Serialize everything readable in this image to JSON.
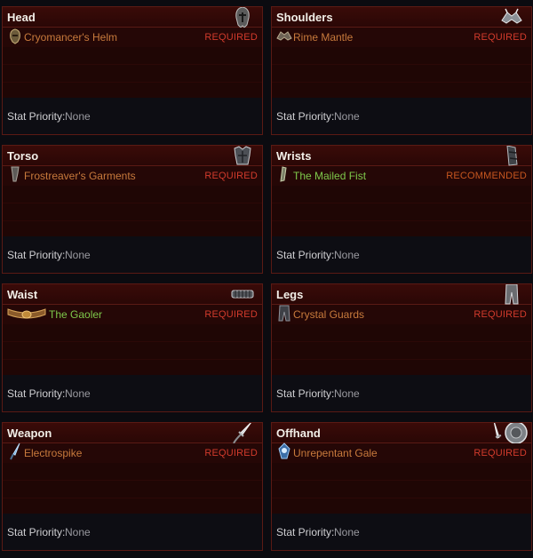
{
  "slots": [
    {
      "title": "Head",
      "icon": "helm-icon",
      "item": "Cryomancer's Helm",
      "item_icon": "helm-item-icon",
      "rarity": "legendary",
      "requirement": "REQUIRED",
      "stat_label": "Stat Priority:",
      "stat_value": "None"
    },
    {
      "title": "Shoulders",
      "icon": "shoulders-icon",
      "item": "Rime Mantle",
      "item_icon": "shoulders-item-icon",
      "rarity": "legendary",
      "requirement": "REQUIRED",
      "stat_label": "Stat Priority:",
      "stat_value": "None"
    },
    {
      "title": "Torso",
      "icon": "chest-armor-icon",
      "item": "Frostreaver's Garments",
      "item_icon": "chest-item-icon",
      "rarity": "legendary",
      "requirement": "REQUIRED",
      "stat_label": "Stat Priority:",
      "stat_value": "None"
    },
    {
      "title": "Wrists",
      "icon": "bracers-icon",
      "item": "The Mailed Fist",
      "item_icon": "bracers-item-icon",
      "rarity": "set",
      "requirement": "RECOMMENDED",
      "stat_label": "Stat Priority:",
      "stat_value": "None"
    },
    {
      "title": "Waist",
      "icon": "belt-icon",
      "item": "The Gaoler",
      "item_icon": "belt-item-icon",
      "rarity": "set",
      "requirement": "REQUIRED",
      "stat_label": "Stat Priority:",
      "stat_value": "None"
    },
    {
      "title": "Legs",
      "icon": "legs-armor-icon",
      "item": "Crystal Guards",
      "item_icon": "legs-item-icon",
      "rarity": "legendary",
      "requirement": "REQUIRED",
      "stat_label": "Stat Priority:",
      "stat_value": "None"
    },
    {
      "title": "Weapon",
      "icon": "dagger-icon",
      "item": "Electrospike",
      "item_icon": "weapon-item-icon",
      "rarity": "legendary",
      "requirement": "REQUIRED",
      "stat_label": "Stat Priority:",
      "stat_value": "None"
    },
    {
      "title": "Offhand",
      "icon": "shield-dagger-icon",
      "item": "Unrepentant Gale",
      "item_icon": "offhand-item-icon",
      "rarity": "legendary",
      "requirement": "REQUIRED",
      "stat_label": "Stat Priority:",
      "stat_value": "None"
    }
  ],
  "colors": {
    "legendary": "#c87a3c",
    "set": "#7ec94b",
    "required": "#d23b2c",
    "recommended": "#c6561f"
  }
}
